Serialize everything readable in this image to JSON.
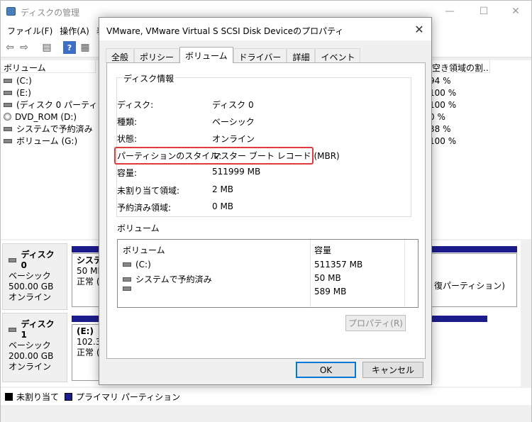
{
  "app": {
    "title": "ディスクの管理"
  },
  "menu": [
    "ファイル(F)",
    "操作(A)",
    "表"
  ],
  "top_list": {
    "headers": {
      "volume": "ボリューム",
      "free_pct": "空き領域の割..."
    },
    "rows": [
      {
        "name": "(C:)",
        "pct": "94 %"
      },
      {
        "name": "(E:)",
        "pct": "100 %"
      },
      {
        "name": "(ディスク 0 パーティシ",
        "pct": "100 %"
      },
      {
        "name": "DVD_ROM (D:)",
        "pct": "0 %"
      },
      {
        "name": "システムで予約済み",
        "pct": "38 %"
      },
      {
        "name": "ボリューム (G:)",
        "pct": "100 %"
      }
    ]
  },
  "disks": [
    {
      "name": "ディスク 0",
      "type": "ベーシック",
      "size": "500.00 GB",
      "status": "オンライン",
      "part_title": "システム",
      "part_size": "50 MB",
      "part_status": "正常 (シ",
      "right_text": "復パーティション)"
    },
    {
      "name": "ディスク 1",
      "type": "ベーシック",
      "size": "200.00 GB",
      "status": "オンライン",
      "part_title": "(E:)",
      "part_size": "102.34",
      "part_status": "正常 (フ"
    }
  ],
  "legend": {
    "unallocated": "未割り当て",
    "primary": "プライマリ パーティション",
    "primary_color": "#1c1c8c"
  },
  "dialog": {
    "title": "VMware, VMware Virtual S SCSI Disk Deviceのプロパティ",
    "tabs": [
      "全般",
      "ポリシー",
      "ボリューム",
      "ドライバー",
      "詳細",
      "イベント"
    ],
    "active_tab": "ボリューム",
    "group_label": "ディスク情報",
    "info": [
      {
        "k": "ディスク:",
        "v": "ディスク 0"
      },
      {
        "k": "種類:",
        "v": "ベーシック"
      },
      {
        "k": "状態:",
        "v": "オンライン"
      },
      {
        "k": "パーティションのスタイル:",
        "v": "マスター ブート レコード (MBR)"
      },
      {
        "k": "容量:",
        "v": "511999 MB"
      },
      {
        "k": "未割り当て領域:",
        "v": "2 MB"
      },
      {
        "k": "予約済み領域:",
        "v": "0 MB"
      }
    ],
    "volumes_label": "ボリューム",
    "vol_headers": {
      "volume": "ボリューム",
      "capacity": "容量"
    },
    "volumes": [
      {
        "name": "(C:)",
        "cap": "511357 MB"
      },
      {
        "name": "システムで予約済み",
        "cap": "50 MB"
      },
      {
        "name": "",
        "cap": "589 MB"
      }
    ],
    "properties_btn": "プロパティ(R)",
    "ok_btn": "OK",
    "cancel_btn": "キャンセル",
    "highlight_color": "#e03b3b"
  }
}
